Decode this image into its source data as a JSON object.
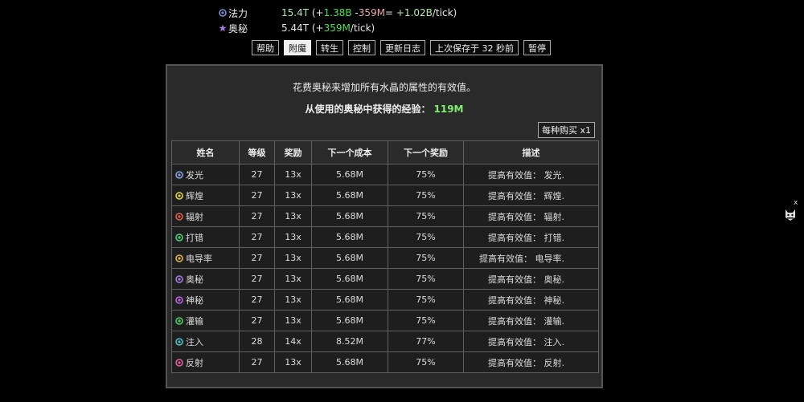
{
  "resources": [
    {
      "name": "法力",
      "icon": "mana-orb-icon",
      "icon_color": "#7a8fd8",
      "value": "15.4T",
      "open": " (+",
      "gain": "1.38B",
      "sep": " -",
      "loss": "359M",
      "eq": "= ",
      "net": "+1.02B",
      "unit": "/tick)"
    },
    {
      "name": "奥秘",
      "icon": "arcane-star-icon",
      "icon_color": "#a77be6",
      "value": "5.44T",
      "open": " (+",
      "gain": "359M",
      "unit": "/tick)"
    }
  ],
  "toolbar": [
    "帮助",
    "附魔",
    "转生",
    "控制",
    "更新日志",
    "上次保存于 32 秒前",
    "暂停"
  ],
  "panel": {
    "description": "花费奥秘来增加所有水晶的属性的有效值。",
    "xp_label": "从使用的奥秘中获得的经验：",
    "xp_value": "119M",
    "buy_button": "每种购买 x1"
  },
  "table": {
    "headers": [
      "姓名",
      "等级",
      "奖励",
      "下一个成本",
      "下一个奖励",
      "描述"
    ],
    "rows": [
      {
        "icon": "glow-icon",
        "color": "#8aa0e0",
        "name": "发光",
        "level": "27",
        "reward": "13x",
        "next_cost": "5.68M",
        "next_reward": "75%",
        "desc": "提高有效值： 发光."
      },
      {
        "icon": "radiance-icon",
        "color": "#e0d24a",
        "name": "辉煌",
        "level": "27",
        "reward": "13x",
        "next_cost": "5.68M",
        "next_reward": "75%",
        "desc": "提高有效值： 辉煌."
      },
      {
        "icon": "radiation-icon",
        "color": "#e0604a",
        "name": "辐射",
        "level": "27",
        "reward": "13x",
        "next_cost": "5.68M",
        "next_reward": "75%",
        "desc": "提高有效值： 辐射."
      },
      {
        "icon": "strike-icon",
        "color": "#4ad07a",
        "name": "打错",
        "level": "27",
        "reward": "13x",
        "next_cost": "5.68M",
        "next_reward": "75%",
        "desc": "提高有效值： 打错."
      },
      {
        "icon": "conductivity-icon",
        "color": "#e0b24a",
        "name": "电导率",
        "level": "27",
        "reward": "13x",
        "next_cost": "5.68M",
        "next_reward": "75%",
        "desc": "提高有效值： 电导率."
      },
      {
        "icon": "arcane-icon",
        "color": "#a77be6",
        "name": "奥秘",
        "level": "27",
        "reward": "13x",
        "next_cost": "5.68M",
        "next_reward": "75%",
        "desc": "提高有效值： 奥秘."
      },
      {
        "icon": "mystic-icon",
        "color": "#c060e0",
        "name": "神秘",
        "level": "27",
        "reward": "13x",
        "next_cost": "5.68M",
        "next_reward": "75%",
        "desc": "提高有效值： 神秘."
      },
      {
        "icon": "infusion-icon",
        "color": "#4ad06a",
        "name": "灌输",
        "level": "27",
        "reward": "13x",
        "next_cost": "5.68M",
        "next_reward": "75%",
        "desc": "提高有效值： 灌输."
      },
      {
        "icon": "inject-icon",
        "color": "#4ac0c0",
        "name": "注入",
        "level": "28",
        "reward": "14x",
        "next_cost": "8.52M",
        "next_reward": "77%",
        "desc": "提高有效值： 注入."
      },
      {
        "icon": "reflect-icon",
        "color": "#e060a0",
        "name": "反射",
        "level": "27",
        "reward": "13x",
        "next_cost": "5.68M",
        "next_reward": "75%",
        "desc": "提高有效值： 反射."
      }
    ]
  },
  "side": {
    "close": "x",
    "avatar": "cat-avatar-icon"
  }
}
